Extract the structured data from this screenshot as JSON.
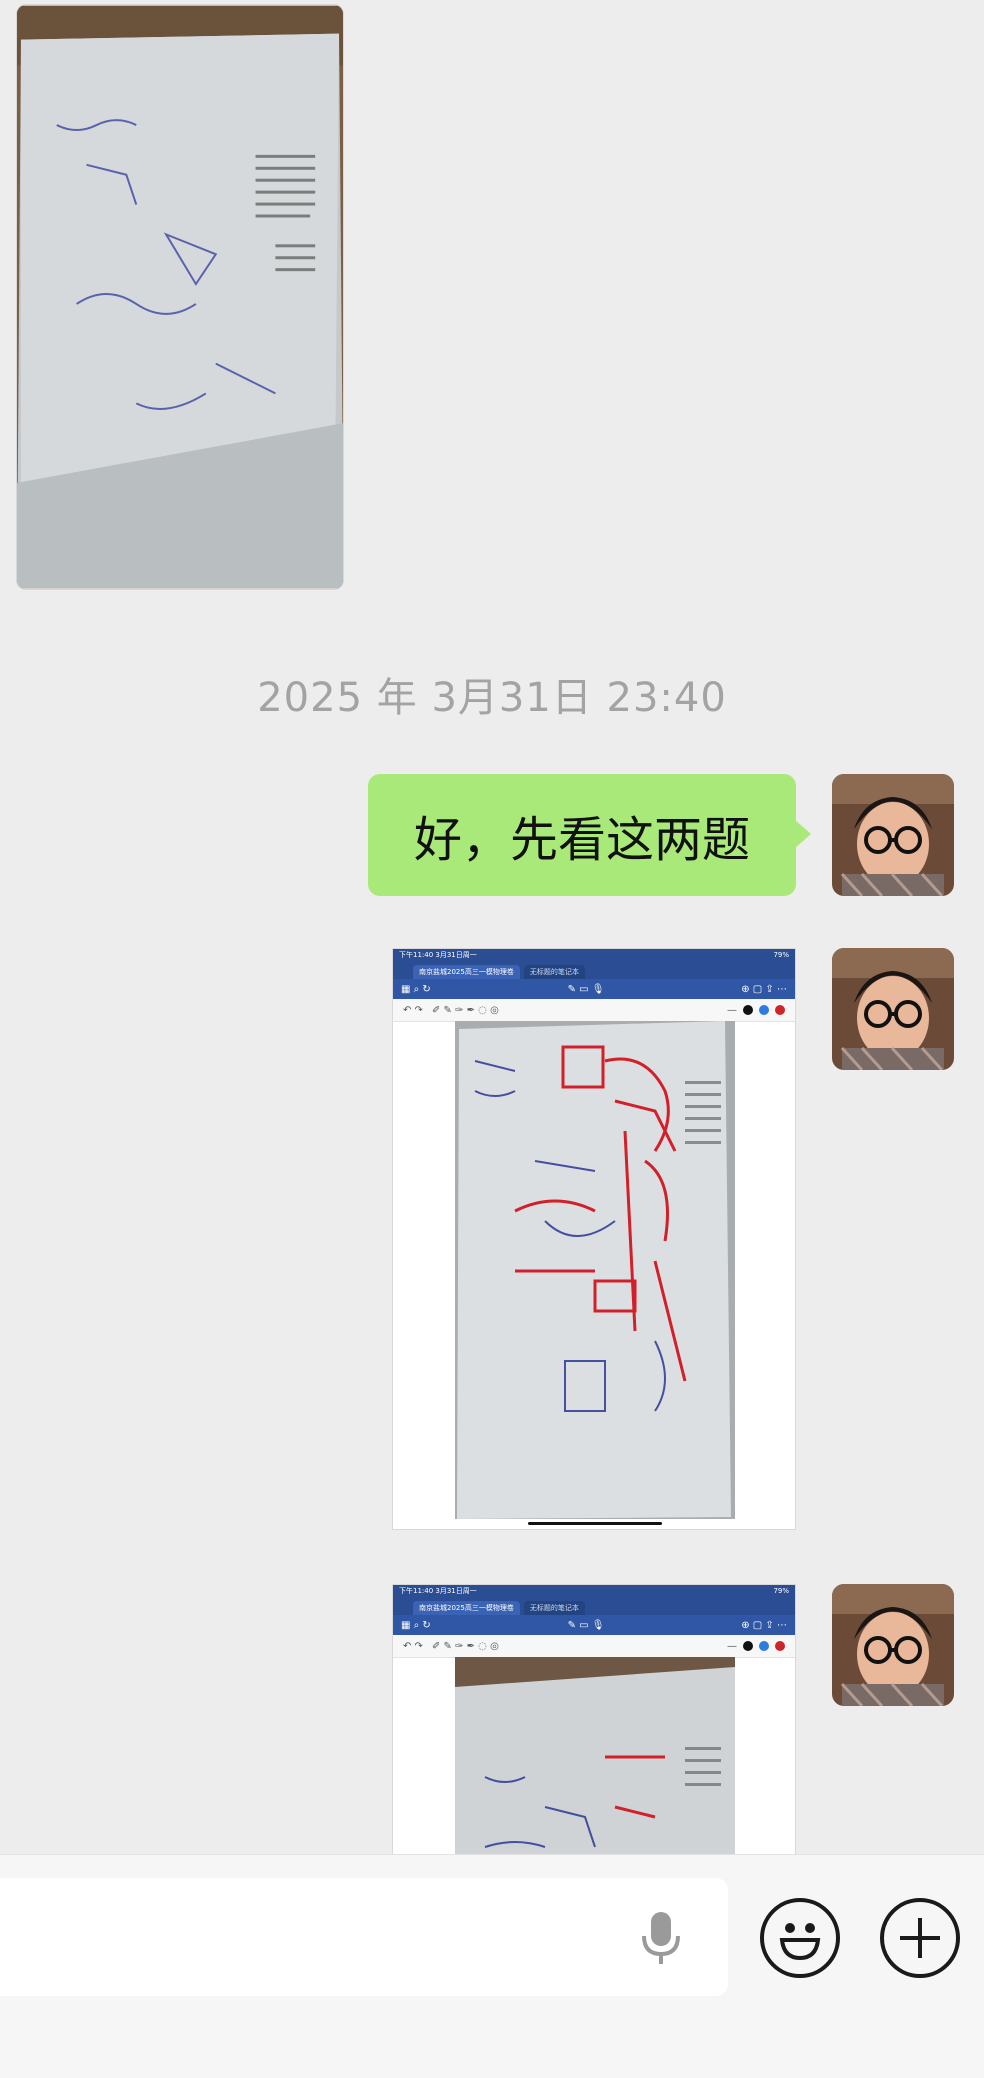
{
  "timestamp": "2025 年 3月31日 23:40",
  "message": {
    "text": "好，先看这两题"
  },
  "shots": [
    {
      "status_time": "下午11:40  3月31日周一",
      "status_battery": "79%",
      "tab_active": "南京盐城2025高三一模物理卷",
      "tab_other": "无标题的笔记本"
    },
    {
      "status_time": "下午11:40  3月31日周一",
      "status_battery": "79%",
      "tab_active": "南京盐城2025高三一模物理卷",
      "tab_other": "无标题的笔记本"
    }
  ],
  "icons": {
    "mic": "microphone-icon",
    "emoji": "smiley-icon",
    "plus": "plus-icon"
  },
  "colors": {
    "bubble": "#a9e97a",
    "background": "#ededed",
    "toolbar_blue": "#2f57a6"
  }
}
